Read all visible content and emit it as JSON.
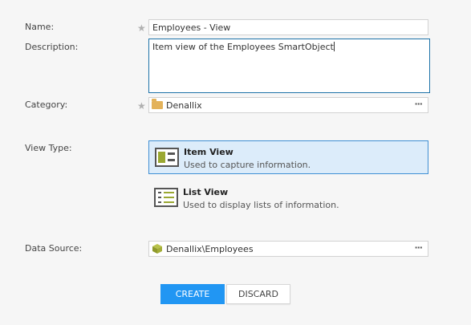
{
  "form": {
    "name_label": "Name:",
    "name_value": "Employees - View",
    "description_label": "Description:",
    "description_value": "Item view of the Employees SmartObject",
    "category_label": "Category:",
    "category_value": "Denallix",
    "view_type_label": "View Type:",
    "data_source_label": "Data Source:",
    "data_source_value": "Denallix\\Employees",
    "required_marker": "★",
    "ellipsis": "···"
  },
  "view_types": [
    {
      "title": "Item View",
      "description": "Used to capture information.",
      "selected": true,
      "icon": "item-view-icon"
    },
    {
      "title": "List View",
      "description": "Used to display lists of information.",
      "selected": false,
      "icon": "list-view-icon"
    }
  ],
  "buttons": {
    "create": "CREATE",
    "discard": "DISCARD"
  },
  "colors": {
    "accent": "#2196f3",
    "selected_bg": "#dcecfa",
    "selected_border": "#3f8fd4",
    "icon_green": "#9aa832",
    "folder": "#e3b25a"
  }
}
